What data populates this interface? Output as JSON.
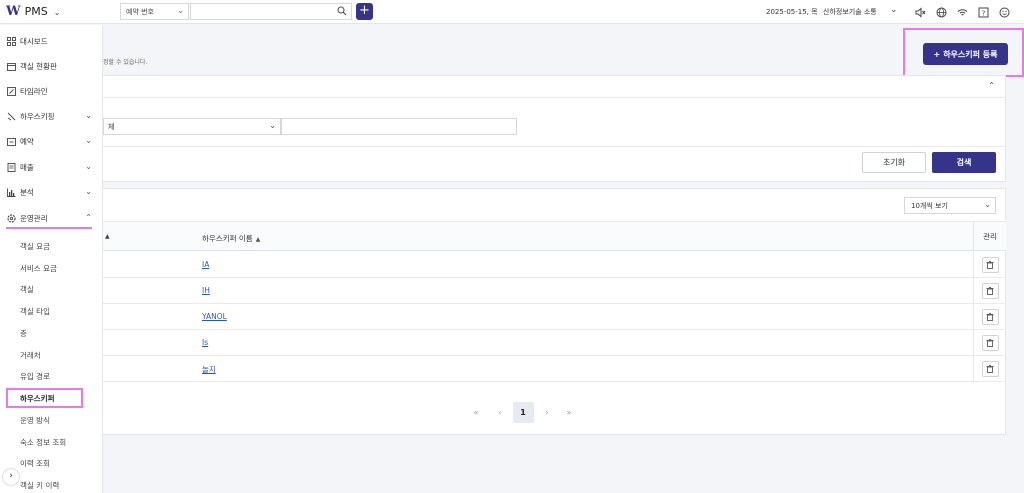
{
  "app": {
    "logo_mark": "W",
    "name": "PMS"
  },
  "topbar": {
    "search_type": "예약 번호",
    "search_placeholder": "",
    "add_label": "+",
    "date": "2025-05-15, 목",
    "company": "산하정보기술 소통"
  },
  "sidebar": {
    "items": [
      {
        "label": "대시보드",
        "icon": "dashboard-icon",
        "has_chevron": false
      },
      {
        "label": "객실 현황판",
        "icon": "calendar-icon",
        "has_chevron": false
      },
      {
        "label": "타임라인",
        "icon": "timeline-icon",
        "has_chevron": false
      },
      {
        "label": "하우스키핑",
        "icon": "housekeeping-icon",
        "has_chevron": true
      },
      {
        "label": "예약",
        "icon": "reservation-icon",
        "has_chevron": true
      },
      {
        "label": "매출",
        "icon": "sales-icon",
        "has_chevron": true
      },
      {
        "label": "분석",
        "icon": "chart-icon",
        "has_chevron": true
      },
      {
        "label": "운영관리",
        "icon": "gear-icon",
        "has_chevron": true,
        "expanded": true
      }
    ],
    "sub_items": [
      {
        "label": "객실 요금"
      },
      {
        "label": "서비스 요금"
      },
      {
        "label": "객실"
      },
      {
        "label": "객실 타입"
      },
      {
        "label": "층"
      },
      {
        "label": "거래처"
      },
      {
        "label": "유입 경로"
      },
      {
        "label": "하우스키퍼",
        "active": true
      },
      {
        "label": "운영 방식"
      },
      {
        "label": "숙소 정보 조회"
      },
      {
        "label": "이력 조회"
      },
      {
        "label": "객실 키 이력"
      }
    ],
    "collapse_label": "›"
  },
  "main": {
    "description": "정할 수 있습니다.",
    "register_button": "하우스키퍼 등록",
    "register_plus": "+",
    "filter": {
      "select_value": "체",
      "input_value": "",
      "reset_label": "초기화",
      "search_label": "검색"
    },
    "table": {
      "page_size": "10개씩 보기",
      "col_sort_first": "▲",
      "col_name": "하우스키퍼 이름",
      "col_name_sort": "▲",
      "col_manage": "관리",
      "rows": [
        {
          "name": "IA"
        },
        {
          "name": "IH"
        },
        {
          "name": "YANOL"
        },
        {
          "name": "Is"
        },
        {
          "name": "놀지"
        }
      ]
    },
    "pagination": {
      "first": "«",
      "prev": "‹",
      "current": "1",
      "next": "›",
      "last": "»"
    }
  },
  "colors": {
    "accent": "#35338a",
    "highlight": "#e879e8",
    "link": "#2a55c8"
  }
}
